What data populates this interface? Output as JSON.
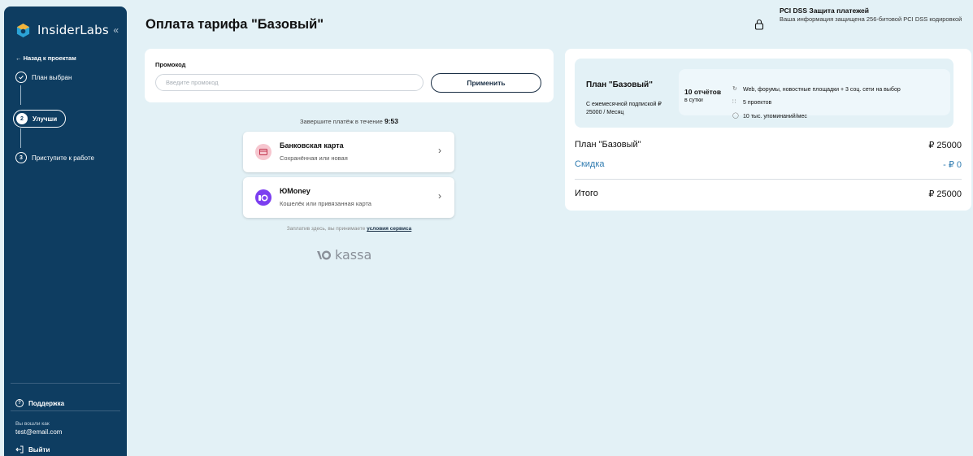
{
  "sidebar": {
    "logo": "InsiderLabs",
    "back": "← Назад к проектам",
    "steps": [
      {
        "num": "",
        "label": "План выбран"
      },
      {
        "num": "2",
        "label": "Улучши"
      },
      {
        "num": "3",
        "label": "Приступите к работе"
      }
    ],
    "support": "Поддержка",
    "logged_in_label": "Вы вошли как",
    "email": "test@email.com",
    "logout": "Выйти"
  },
  "header": {
    "title": "Оплата тарифа \"Базовый\"",
    "pci_title": "PCI DSS Защита платежей",
    "pci_subtitle": "Ваша информация защищена 256-битовой PCI DSS кодировкой"
  },
  "promo": {
    "label": "Промокод",
    "placeholder": "Введите промокод",
    "apply": "Применить"
  },
  "timer": {
    "text": "Завершите платёж в течение",
    "value": "9:53"
  },
  "payment": [
    {
      "title": "Банковская карта",
      "subtitle": "Сохранённая или новая"
    },
    {
      "title": "ЮMoney",
      "subtitle": "Кошелёк или привязанная карта"
    }
  ],
  "terms": {
    "text": "Заплатив здесь, вы принимаете",
    "link": "условия сервиса"
  },
  "kassa": "kassa",
  "summary": {
    "plan_name": "План \"Базовый\"",
    "plan_desc": "С ежемесячной подпиской ₽ 25000 / Месяц",
    "reports": "10 отчётов",
    "reports_sub": "в сутки",
    "features": [
      "Web, форумы, новостные площадки + 3 соц. сети на выбор",
      "5 проектов",
      "10 тыс. упоминаний/мес"
    ],
    "rows": [
      {
        "label": "План \"Базовый\"",
        "value": "₽ 25000"
      },
      {
        "label": "Скидка",
        "value": "- ₽ 0"
      },
      {
        "label": "Итого",
        "value": "₽ 25000"
      }
    ]
  },
  "colors": {
    "sidebar_bg": "#0e3d61",
    "page_bg": "#e3f1f6",
    "discount": "#2f7bb0",
    "yoomoney": "#7c3ef0"
  }
}
